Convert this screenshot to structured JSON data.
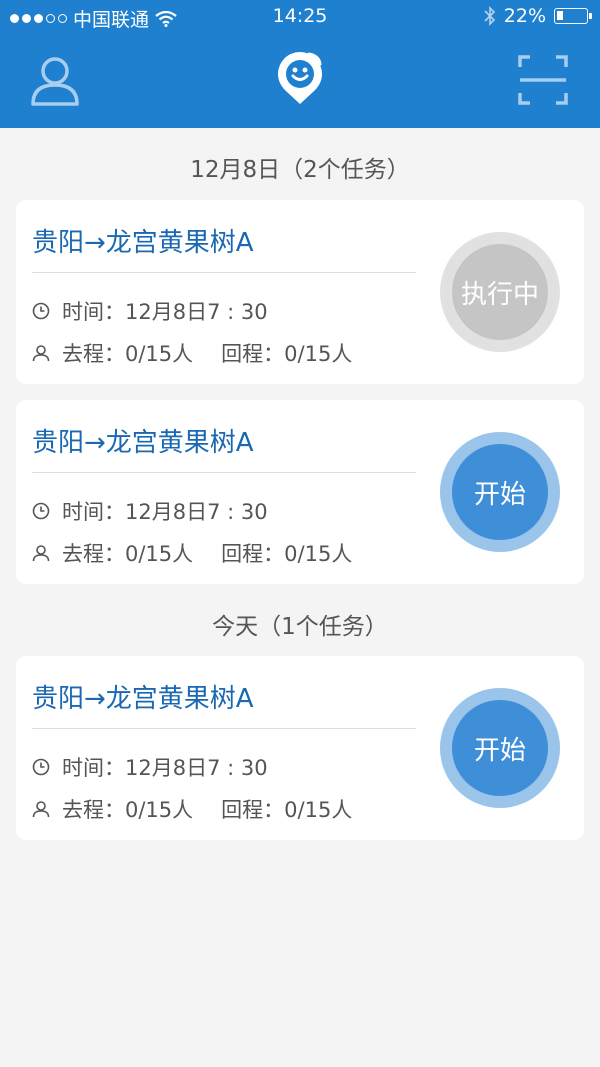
{
  "status_bar": {
    "carrier": "中国联通",
    "time": "14:25",
    "battery": "22%",
    "battery_level": 0.22,
    "signal_bars_filled": 3,
    "signal_bars_total": 5
  },
  "nav": {
    "left_icon": "user-profile-icon",
    "center_icon": "location-pin-logo-icon",
    "right_icon": "scan-frame-icon"
  },
  "colors": {
    "brand": "#1f80d0",
    "route_text": "#1a68b3",
    "start_button": "#3e8ed8",
    "start_button_ring": "#9ac4ea",
    "running_button": "#c5c5c5",
    "running_button_ring": "#e1e1e1"
  },
  "sections": [
    {
      "header": "12月8日（2个任务）",
      "tasks": [
        {
          "route": "贵阳→龙宫黄果树A",
          "time_label": "时间：",
          "time": "12月8日7 : 30",
          "outbound_label": "去程：",
          "outbound": "0/15人",
          "return_label": "回程：",
          "return": "0/15人",
          "action": "执行中",
          "state": "running"
        },
        {
          "route": "贵阳→龙宫黄果树A",
          "time_label": "时间：",
          "time": "12月8日7 : 30",
          "outbound_label": "去程：",
          "outbound": "0/15人",
          "return_label": "回程：",
          "return": "0/15人",
          "action": "开始",
          "state": "start"
        }
      ]
    },
    {
      "header": "今天（1个任务）",
      "tasks": [
        {
          "route": "贵阳→龙宫黄果树A",
          "time_label": "时间：",
          "time": "12月8日7 : 30",
          "outbound_label": "去程：",
          "outbound": "0/15人",
          "return_label": "回程：",
          "return": "0/15人",
          "action": "开始",
          "state": "start"
        }
      ]
    }
  ]
}
